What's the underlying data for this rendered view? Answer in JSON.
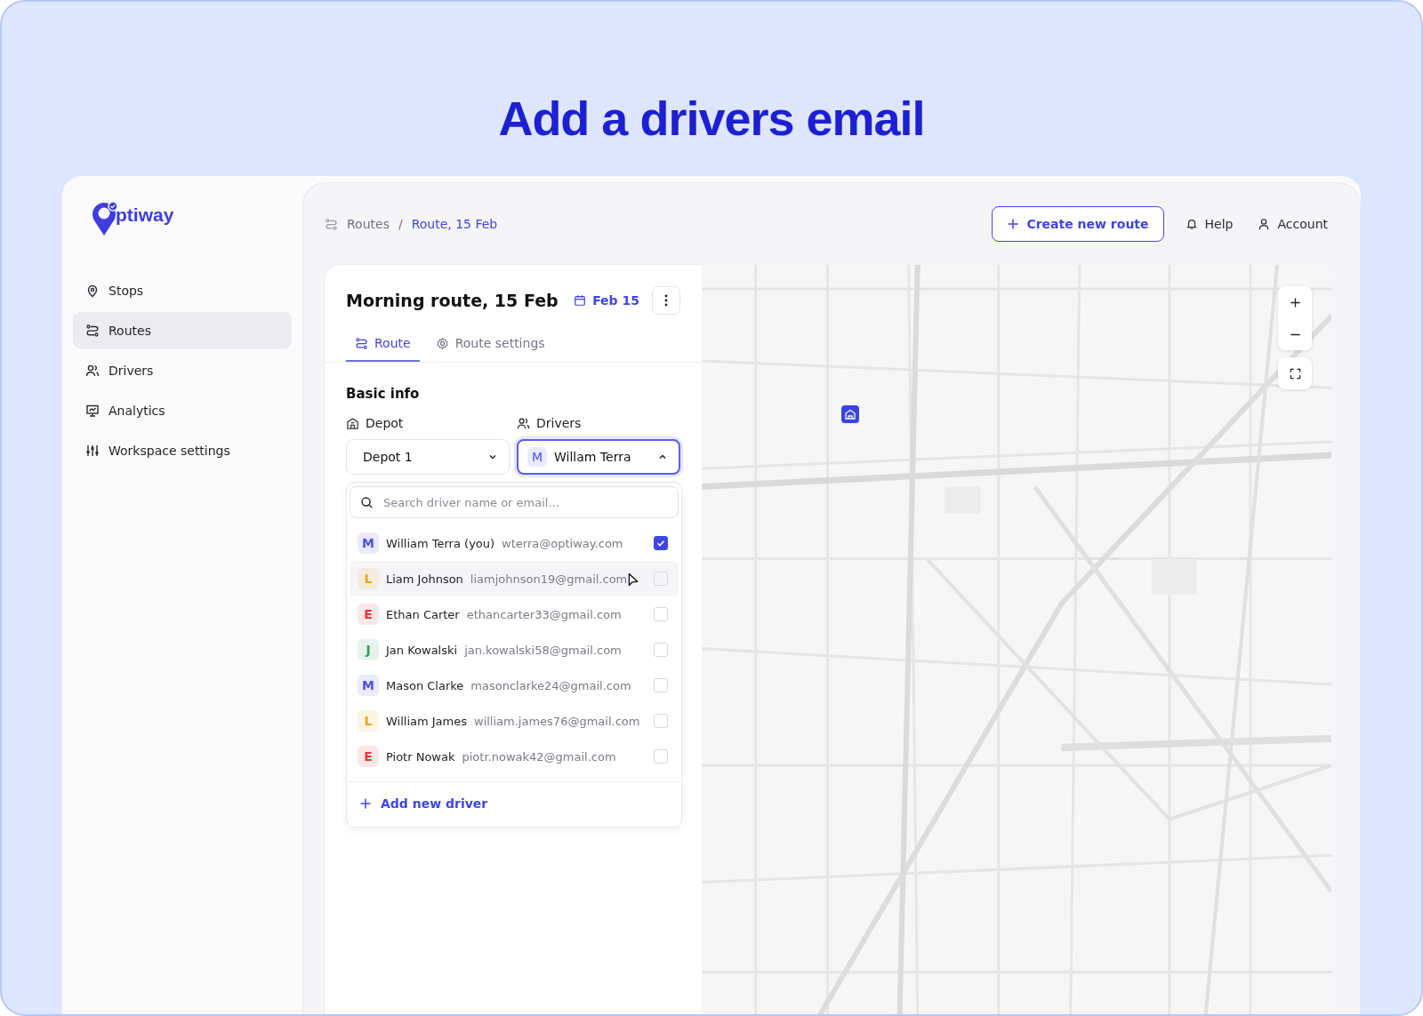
{
  "headline": "Add a drivers email",
  "logo": {
    "text": "ptiway"
  },
  "sidebar": {
    "items": [
      {
        "label": "Stops",
        "kind": "pin",
        "selected": false
      },
      {
        "label": "Routes",
        "kind": "route",
        "selected": true
      },
      {
        "label": "Drivers",
        "kind": "users",
        "selected": false
      },
      {
        "label": "Analytics",
        "kind": "chart",
        "selected": false
      },
      {
        "label": "Workspace settings",
        "kind": "sliders",
        "selected": false
      }
    ]
  },
  "breadcrumb": [
    "Routes",
    "Route, 15 Feb"
  ],
  "breadcrumb_separator": "/",
  "header": {
    "create_button": "Create new route",
    "help": "Help",
    "account": "Account"
  },
  "card": {
    "title": "Morning route, 15 Feb",
    "date": "Feb 15",
    "tabs": [
      {
        "label": "Route",
        "kind": "route",
        "selected": true
      },
      {
        "label": "Route settings",
        "kind": "gear",
        "selected": false
      }
    ],
    "section": "Basic info",
    "depot": {
      "label": "Depot",
      "value": "Depot 1",
      "expanded": false
    },
    "drivers": {
      "label": "Drivers",
      "initial": "M",
      "value": "Willam Terra",
      "expanded": true
    },
    "dropdown": {
      "placeholder": "Search driver name or email...",
      "options": [
        {
          "initial": "M",
          "color": "#4a4fe0",
          "name": "William Terra (you)",
          "email": "wterra@optiway.com",
          "checked": true,
          "hovered": false
        },
        {
          "initial": "L",
          "color": "#f0a11c",
          "name": "Liam Johnson",
          "email": "liamjohnson19@gmail.com",
          "checked": false,
          "hovered": true
        },
        {
          "initial": "E",
          "color": "#e2363a",
          "name": "Ethan Carter",
          "email": "ethancarter33@gmail.com",
          "checked": false,
          "hovered": false
        },
        {
          "initial": "J",
          "color": "#2f9d55",
          "name": "Jan Kowalski",
          "email": "jan.kowalski58@gmail.com",
          "checked": false,
          "hovered": false
        },
        {
          "initial": "M",
          "color": "#4a4fe0",
          "name": "Mason Clarke",
          "email": "masonclarke24@gmail.com",
          "checked": false,
          "hovered": false
        },
        {
          "initial": "L",
          "color": "#f0a11c",
          "name": "William James",
          "email": "william.james76@gmail.com",
          "checked": false,
          "hovered": false
        },
        {
          "initial": "E",
          "color": "#e2363a",
          "name": "Piotr Nowak",
          "email": "piotr.nowak42@gmail.com",
          "checked": false,
          "hovered": false
        }
      ],
      "add": "Add new driver"
    }
  }
}
